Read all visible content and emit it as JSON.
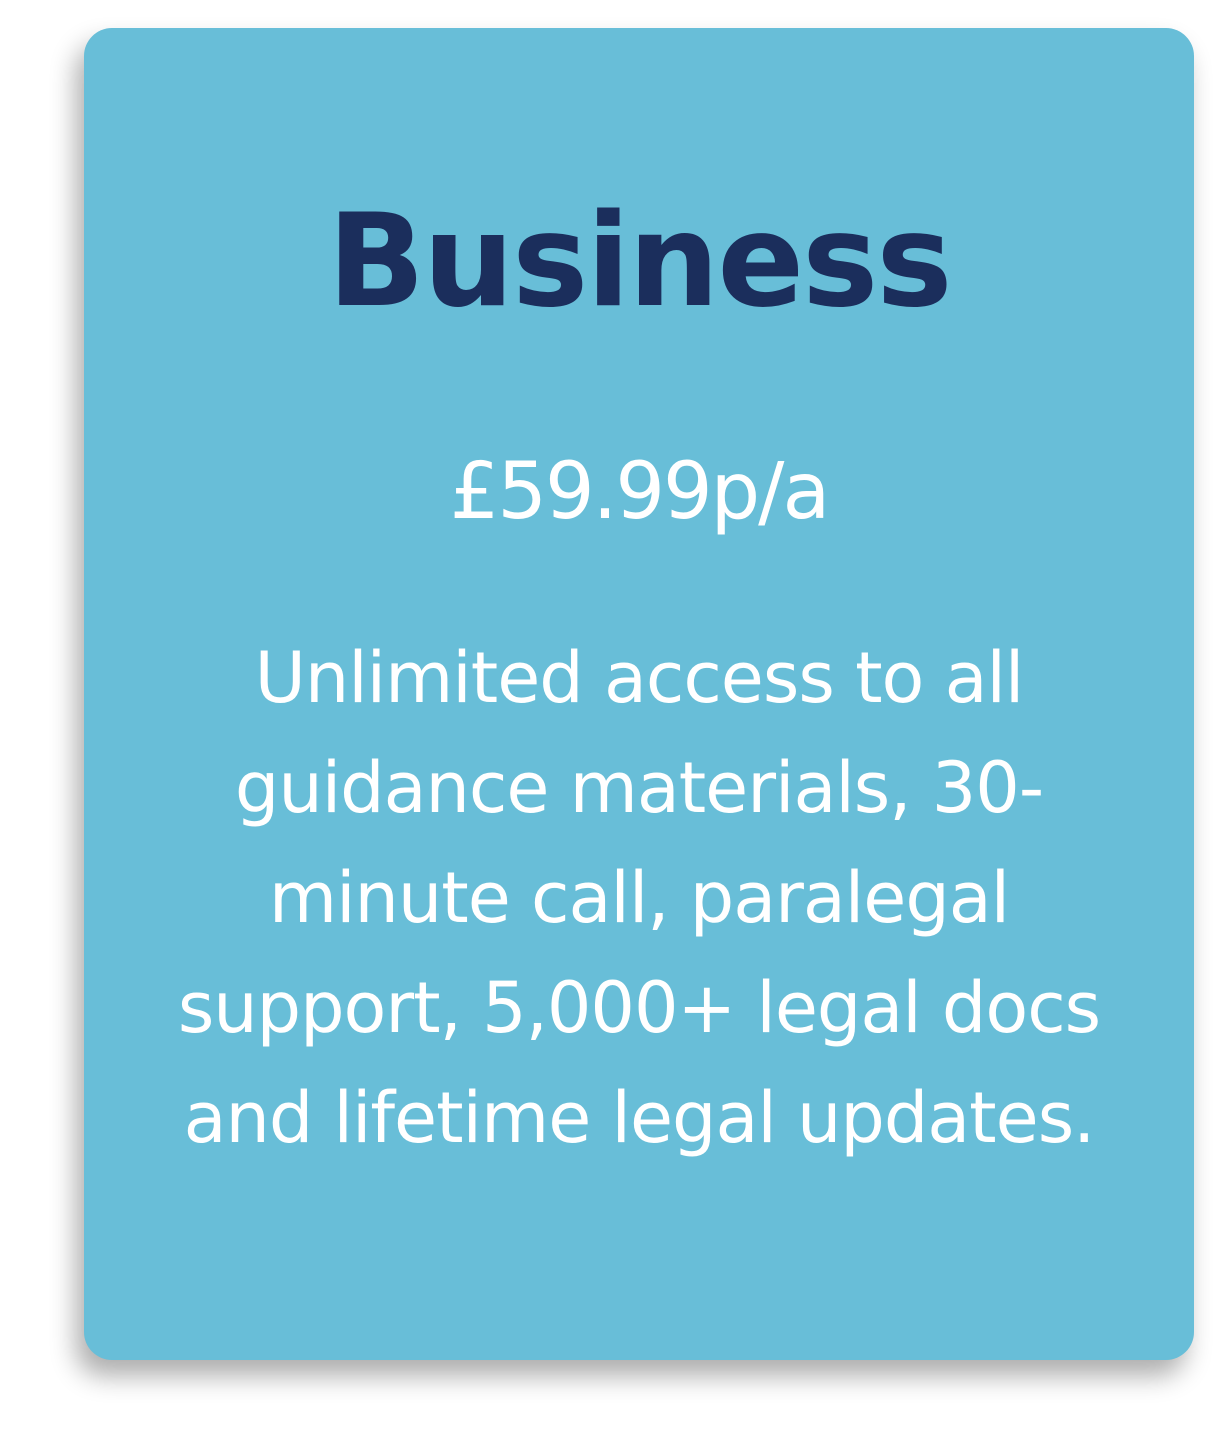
{
  "plan": {
    "name": "Business",
    "price": "£59.99p/a",
    "description": "Unlimited access to all guidance materials, 30-minute call, paralegal support, 5,000+ legal docs and lifetime legal updates."
  },
  "colors": {
    "card_background": "#68bed8",
    "title": "#1b2e5c",
    "text": "#ffffff"
  }
}
